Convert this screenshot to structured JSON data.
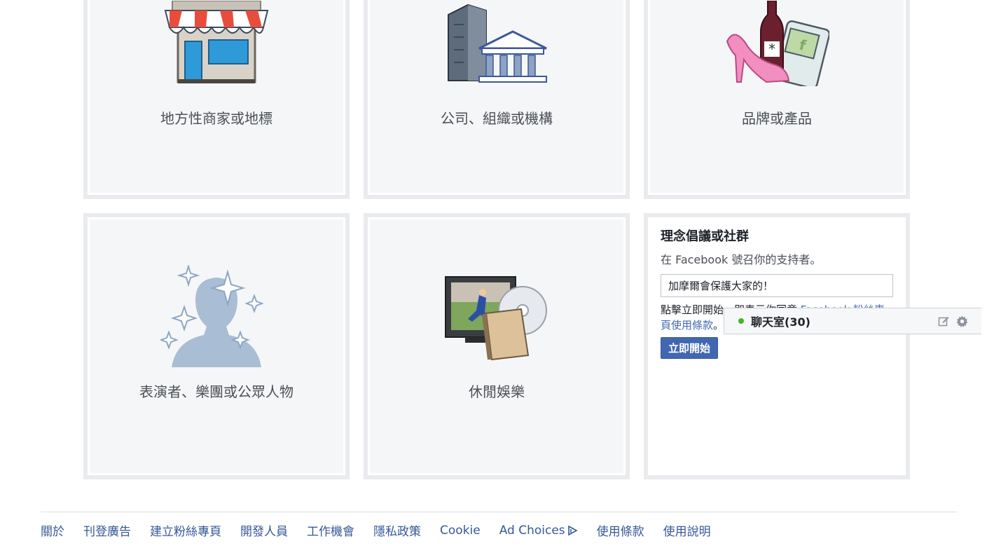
{
  "categories": [
    {
      "label": "地方性商家或地標",
      "icon": "storefront-icon"
    },
    {
      "label": "公司、組織或機構",
      "icon": "office-building-icon"
    },
    {
      "label": "品牌或產品",
      "icon": "brand-products-icon"
    },
    {
      "label": "表演者、樂團或公眾人物",
      "icon": "public-figure-icon"
    },
    {
      "label": "休閒娛樂",
      "icon": "entertainment-icon"
    }
  ],
  "cause_card": {
    "title": "理念倡議或社群",
    "subtitle": "在 Facebook 號召你的支持者。",
    "name_input_value": "加摩爾會保護大家的！",
    "terms_prefix": "點擊立即開始，即表示你同意 ",
    "terms_link": "Facebook 粉絲專頁使用條款",
    "terms_suffix": "。",
    "start_button": "立即開始"
  },
  "chat": {
    "label": "聊天室(30)",
    "status_color": "#42b72a",
    "icons": [
      "compose-icon",
      "gear-icon"
    ]
  },
  "footer": {
    "links": [
      "關於",
      "刊登廣告",
      "建立粉絲專頁",
      "開發人員",
      "工作機會",
      "隱私政策",
      "Cookie",
      "Ad Choices",
      "使用條款",
      "使用說明"
    ]
  },
  "colors": {
    "facebook_blue": "#4267b2",
    "link_blue": "#365899",
    "tile_border": "#e9ebee",
    "tile_bg": "#f5f6f7"
  }
}
